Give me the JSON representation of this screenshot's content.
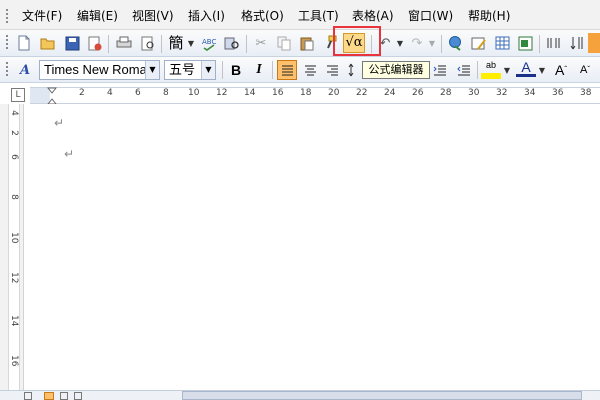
{
  "menu": {
    "items": [
      {
        "label": "文件(F)"
      },
      {
        "label": "编辑(E)"
      },
      {
        "label": "视图(V)"
      },
      {
        "label": "插入(I)"
      },
      {
        "label": "格式(O)"
      },
      {
        "label": "工具(T)"
      },
      {
        "label": "表格(A)"
      },
      {
        "label": "窗口(W)"
      },
      {
        "label": "帮助(H)"
      }
    ]
  },
  "toolbar": {
    "traditional_char": "簡",
    "formula_symbol": "√α",
    "tooltip": "公式编辑器"
  },
  "format_bar": {
    "style_icon_text": "A",
    "font_name": "Times New Roma",
    "font_size": "五号",
    "bold": "B",
    "italic": "I",
    "highlight_text": "ab",
    "font_color_text": "A"
  },
  "ruler": {
    "corner": "L",
    "horizontal_ticks": [
      "2",
      "4",
      "6",
      "8",
      "10",
      "12",
      "14",
      "16",
      "18",
      "20",
      "22",
      "24",
      "26",
      "28",
      "30",
      "32",
      "34",
      "36",
      "38"
    ],
    "vertical_ticks": [
      "4",
      "2",
      "6",
      "8",
      "10",
      "12",
      "14",
      "16"
    ]
  },
  "document": {
    "paragraph_mark": "↵"
  },
  "colors": {
    "highlight_border": "#e8343c",
    "formula_active": "#ffd98a",
    "tooltip_bg": "#ffffe1"
  }
}
